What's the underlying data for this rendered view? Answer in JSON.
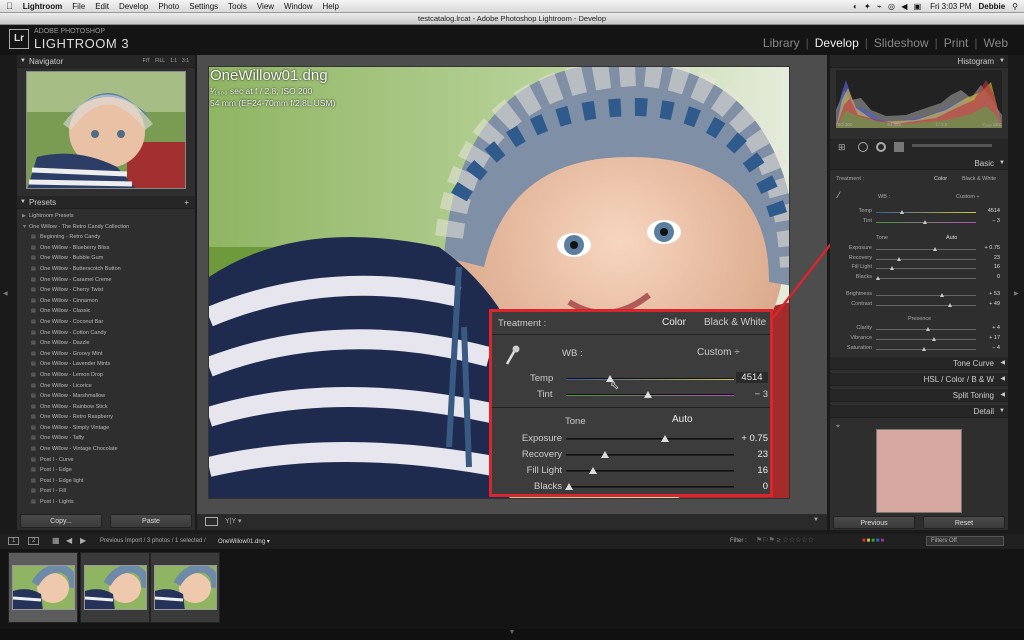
{
  "menubar": {
    "apple": "",
    "items": [
      "Lightroom",
      "File",
      "Edit",
      "Develop",
      "Photo",
      "Settings",
      "Tools",
      "View",
      "Window",
      "Help"
    ],
    "clock": "Fri 3:03 PM",
    "user": "Debbie"
  },
  "window_title": "testcatalog.lrcat - Adobe Photoshop Lightroom - Develop",
  "identity": {
    "logo": "Lr",
    "adobe": "ADOBE PHOTOSHOP",
    "product": "LIGHTROOM 3"
  },
  "modules": [
    "Library",
    "Develop",
    "Slideshow",
    "Print",
    "Web"
  ],
  "navigator": {
    "title": "Navigator",
    "options": [
      "FIT",
      "FILL",
      "1:1",
      "3:1"
    ]
  },
  "presets": {
    "title": "Presets",
    "add": "+",
    "items": [
      {
        "label": "Lightroom Presets",
        "folder": true
      },
      {
        "label": "One Willow - The Retro Candy Collection",
        "folder": true
      },
      {
        "label": "Beginning - Retro Candy",
        "folder": false
      },
      {
        "label": "One Willow - Blueberry Bliss",
        "folder": false
      },
      {
        "label": "One Willow - Bubble Gum",
        "folder": false
      },
      {
        "label": "One Willow - Butterscotch Button",
        "folder": false
      },
      {
        "label": "One Willow - Caramel Creme",
        "folder": false
      },
      {
        "label": "One Willow - Cherry Twist",
        "folder": false
      },
      {
        "label": "One Willow - Cinnamon",
        "folder": false
      },
      {
        "label": "One Willow - Classic",
        "folder": false
      },
      {
        "label": "One Willow - Coconut Bar",
        "folder": false
      },
      {
        "label": "One Willow - Cotton Candy",
        "folder": false
      },
      {
        "label": "One Willow - Dazzle",
        "folder": false
      },
      {
        "label": "One Willow - Groovy Mint",
        "folder": false
      },
      {
        "label": "One Willow - Lavender Mints",
        "folder": false
      },
      {
        "label": "One Willow - Lemon Drop",
        "folder": false
      },
      {
        "label": "One Willow - Licorice",
        "folder": false
      },
      {
        "label": "One Willow - Marshmallow",
        "folder": false
      },
      {
        "label": "One Willow - Rainbow Stick",
        "folder": false
      },
      {
        "label": "One Willow - Retro Raspberry",
        "folder": false
      },
      {
        "label": "One Willow - Simply Vintage",
        "folder": false
      },
      {
        "label": "One Willow - Taffy",
        "folder": false
      },
      {
        "label": "One Willow - Vintage Chocolate",
        "folder": false
      },
      {
        "label": "Post I - Curve",
        "folder": false
      },
      {
        "label": "Post I - Edge",
        "folder": false
      },
      {
        "label": "Post I - Edge light",
        "folder": false
      },
      {
        "label": "Post I - Fill",
        "folder": false
      },
      {
        "label": "Post I - Lights",
        "folder": false
      }
    ]
  },
  "left_buttons": {
    "copy": "Copy...",
    "paste": "Paste"
  },
  "photo_info": {
    "filename": "OneWillow01.dng",
    "exif": "¹⁄₁₆₀₀ sec at f / 2.8, ISO 200",
    "lens": "54 mm (EF24-70mm f/2.8L USM)"
  },
  "zoom_callout": {
    "treatment_label": "Treatment :",
    "color": "Color",
    "bw": "Black & White",
    "wb_label": "WB :",
    "wb_value": "Custom ÷",
    "temp_label": "Temp",
    "temp_value": "4514",
    "temp_pos": 0.26,
    "tint_label": "Tint",
    "tint_value": "− 3",
    "tint_pos": 0.49,
    "tone_label": "Tone",
    "auto": "Auto",
    "sliders": [
      {
        "label": "Exposure",
        "value": "+ 0.75",
        "pos": 0.59
      },
      {
        "label": "Recovery",
        "value": "23",
        "pos": 0.23
      },
      {
        "label": "Fill Light",
        "value": "16",
        "pos": 0.16
      },
      {
        "label": "Blacks",
        "value": "0",
        "pos": 0.02
      }
    ]
  },
  "right_panel": {
    "histogram_title": "Histogram",
    "histo_meta": [
      "ISO 200",
      "54 mm",
      "f / 2.8",
      "¹⁄₁₆₀₀ SEC"
    ],
    "basic_title": "Basic",
    "treatment": "Treatment :",
    "color": "Color",
    "bw": "Black & White",
    "wb_label": "WB :",
    "wb_value": "Custom ÷",
    "wb_sliders": [
      {
        "label": "Temp",
        "value": "4514",
        "pos": 0.26
      },
      {
        "label": "Tint",
        "value": "− 3",
        "pos": 0.49
      }
    ],
    "tone_label": "Tone",
    "auto": "Auto",
    "tone_sliders": [
      {
        "label": "Exposure",
        "value": "+ 0.75",
        "pos": 0.59
      },
      {
        "label": "Recovery",
        "value": "23",
        "pos": 0.23
      },
      {
        "label": "Fill Light",
        "value": "16",
        "pos": 0.16
      },
      {
        "label": "Blacks",
        "value": "0",
        "pos": 0.02
      },
      {
        "label": "Brightness",
        "value": "+ 53",
        "pos": 0.66
      },
      {
        "label": "Contrast",
        "value": "+ 49",
        "pos": 0.74
      }
    ],
    "presence_label": "Presence",
    "presence_sliders": [
      {
        "label": "Clarity",
        "value": "+ 4",
        "pos": 0.52
      },
      {
        "label": "Vibrance",
        "value": "+ 17",
        "pos": 0.58
      },
      {
        "label": "Saturation",
        "value": "− 4",
        "pos": 0.48
      }
    ],
    "sections": [
      "Tone Curve",
      "HSL / Color / B & W",
      "Split Toning",
      "Detail"
    ],
    "buttons": {
      "previous": "Previous",
      "reset": "Reset"
    }
  },
  "filmstrip": {
    "pages": [
      "1",
      "2"
    ],
    "path_prefix": "Previous Import / 3 photos / 1 selected /",
    "path_file": "OneWillow01.dng ▾",
    "filter_label": "Filter :",
    "filters_off": "Filters Off"
  },
  "colors": {
    "callout": "#d8262c",
    "accent": "#eeeeee"
  }
}
